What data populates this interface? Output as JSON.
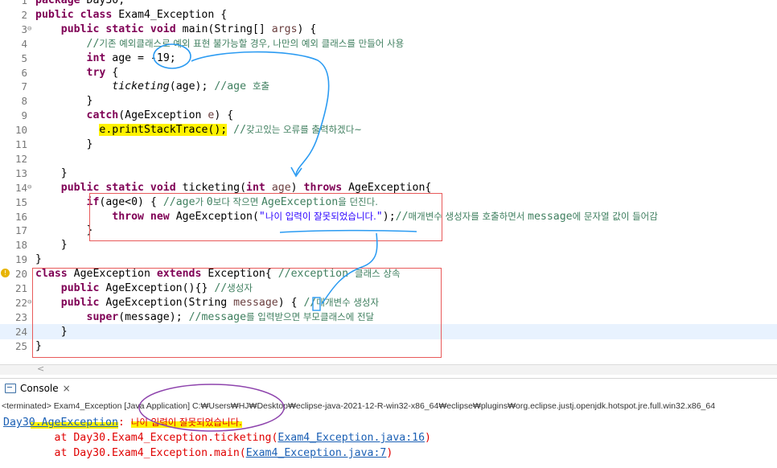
{
  "editor": {
    "lines": [
      {
        "n": "1",
        "parts": [
          {
            "t": "package",
            "c": "kw"
          },
          {
            "t": " Day30;",
            "c": "ident"
          }
        ]
      },
      {
        "n": "2",
        "parts": [
          {
            "t": "public class",
            "c": "kw"
          },
          {
            "t": " Exam4_Exception {",
            "c": "ident"
          }
        ]
      },
      {
        "n": "3",
        "fold": true,
        "parts": [
          {
            "t": "    "
          },
          {
            "t": "public static void",
            "c": "kw"
          },
          {
            "t": " main(String[] ",
            "c": "ident"
          },
          {
            "t": "args",
            "c": "param"
          },
          {
            "t": ") {",
            "c": "ident"
          }
        ]
      },
      {
        "n": "4",
        "parts": [
          {
            "t": "        //",
            "c": "cm"
          },
          {
            "t": "기존 예외클래스로 예외 표현 불가능할 경우, 나만의 예외 클래스를 만들어 사용",
            "c": "cm-ko"
          }
        ]
      },
      {
        "n": "5",
        "parts": [
          {
            "t": "        "
          },
          {
            "t": "int",
            "c": "kw"
          },
          {
            "t": " age = -19;",
            "c": "ident"
          }
        ]
      },
      {
        "n": "6",
        "parts": [
          {
            "t": "        "
          },
          {
            "t": "try",
            "c": "kw"
          },
          {
            "t": " {",
            "c": "ident"
          }
        ]
      },
      {
        "n": "7",
        "parts": [
          {
            "t": "            "
          },
          {
            "t": "ticketing",
            "c": "it"
          },
          {
            "t": "(age); ",
            "c": "ident"
          },
          {
            "t": "//age ",
            "c": "cm"
          },
          {
            "t": "호출",
            "c": "cm-ko"
          }
        ]
      },
      {
        "n": "8",
        "parts": [
          {
            "t": "        }",
            "c": "ident"
          }
        ]
      },
      {
        "n": "9",
        "parts": [
          {
            "t": "        "
          },
          {
            "t": "catch",
            "c": "kw"
          },
          {
            "t": "(AgeException ",
            "c": "ident"
          },
          {
            "t": "e",
            "c": "param"
          },
          {
            "t": ") {",
            "c": "ident"
          }
        ]
      },
      {
        "n": "10",
        "parts": [
          {
            "t": "          "
          },
          {
            "t": "e.printStackTrace();",
            "c": "ident hl-yellow"
          },
          {
            "t": " //",
            "c": "cm"
          },
          {
            "t": "갖고있는 오류를 출력하겠다~",
            "c": "cm-ko"
          }
        ]
      },
      {
        "n": "11",
        "parts": [
          {
            "t": "        }",
            "c": "ident"
          }
        ]
      },
      {
        "n": "12",
        "parts": []
      },
      {
        "n": "13",
        "parts": [
          {
            "t": "    }",
            "c": "ident"
          }
        ]
      },
      {
        "n": "14",
        "fold": true,
        "parts": [
          {
            "t": "    "
          },
          {
            "t": "public static void",
            "c": "kw"
          },
          {
            "t": " ticketing(",
            "c": "ident"
          },
          {
            "t": "int",
            "c": "kw"
          },
          {
            "t": " ",
            "c": "ident"
          },
          {
            "t": "age",
            "c": "param"
          },
          {
            "t": ") ",
            "c": "ident"
          },
          {
            "t": "throws",
            "c": "kw"
          },
          {
            "t": " AgeException{",
            "c": "ident"
          }
        ]
      },
      {
        "n": "15",
        "parts": [
          {
            "t": "        "
          },
          {
            "t": "if",
            "c": "kw"
          },
          {
            "t": "(age<0) { ",
            "c": "ident"
          },
          {
            "t": "//age",
            "c": "cm"
          },
          {
            "t": "가 ",
            "c": "cm-ko"
          },
          {
            "t": "0",
            "c": "cm"
          },
          {
            "t": "보다 작으면 ",
            "c": "cm-ko"
          },
          {
            "t": "AgeException",
            "c": "cm"
          },
          {
            "t": "을 던진다.",
            "c": "cm-ko"
          }
        ]
      },
      {
        "n": "16",
        "parts": [
          {
            "t": "            "
          },
          {
            "t": "throw new",
            "c": "kw"
          },
          {
            "t": " AgeException(",
            "c": "ident"
          },
          {
            "t": "\"",
            "c": "str"
          },
          {
            "t": "나이 입력이 잘못되었습니다.",
            "c": "str-ko"
          },
          {
            "t": "\"",
            "c": "str"
          },
          {
            "t": ");",
            "c": "ident"
          },
          {
            "t": "//",
            "c": "cm"
          },
          {
            "t": "매개변수 생성자를 호출하면서 ",
            "c": "cm-ko"
          },
          {
            "t": "message",
            "c": "cm"
          },
          {
            "t": "에 문자열 값이 들어감",
            "c": "cm-ko"
          }
        ]
      },
      {
        "n": "17",
        "parts": [
          {
            "t": "        }",
            "c": "ident"
          }
        ]
      },
      {
        "n": "18",
        "parts": [
          {
            "t": "    }",
            "c": "ident"
          }
        ]
      },
      {
        "n": "19",
        "parts": [
          {
            "t": "}",
            "c": "ident"
          }
        ]
      },
      {
        "n": "20",
        "warn": true,
        "parts": [
          {
            "t": "class",
            "c": "kw"
          },
          {
            "t": " AgeException ",
            "c": "ident"
          },
          {
            "t": "extends",
            "c": "kw"
          },
          {
            "t": " Exception{ ",
            "c": "ident"
          },
          {
            "t": "//exception ",
            "c": "cm"
          },
          {
            "t": "클래스 상속",
            "c": "cm-ko"
          }
        ]
      },
      {
        "n": "21",
        "parts": [
          {
            "t": "    "
          },
          {
            "t": "public",
            "c": "kw"
          },
          {
            "t": " AgeException(){} ",
            "c": "ident"
          },
          {
            "t": "//",
            "c": "cm"
          },
          {
            "t": "생성자",
            "c": "cm-ko"
          }
        ]
      },
      {
        "n": "22",
        "fold": true,
        "parts": [
          {
            "t": "    "
          },
          {
            "t": "public",
            "c": "kw"
          },
          {
            "t": " AgeException(String ",
            "c": "ident"
          },
          {
            "t": "message",
            "c": "param"
          },
          {
            "t": ") { ",
            "c": "ident"
          },
          {
            "t": "//",
            "c": "cm"
          },
          {
            "t": "매개변수 생성자",
            "c": "cm-ko"
          }
        ]
      },
      {
        "n": "23",
        "parts": [
          {
            "t": "        "
          },
          {
            "t": "super",
            "c": "kw"
          },
          {
            "t": "(message); ",
            "c": "ident"
          },
          {
            "t": "//message",
            "c": "cm"
          },
          {
            "t": "를 입력받으면 부모클래스에 전달",
            "c": "cm-ko"
          }
        ]
      },
      {
        "n": "24",
        "cur": true,
        "parts": [
          {
            "t": "    }",
            "c": "ident"
          }
        ]
      },
      {
        "n": "25",
        "parts": [
          {
            "t": "}",
            "c": "ident"
          }
        ]
      }
    ]
  },
  "console": {
    "tab_label": "Console",
    "terminated": "<terminated> Exam4_Exception [Java Application] C:₩Users₩HJ₩Desktop₩eclipse-java-2021-12-R-win32-x86_64₩eclipse₩plugins₩org.eclipse.justj.openjdk.hotspot.jre.full.win32.x86_64",
    "error_class": "Day30.AgeException",
    "error_sep": ": ",
    "error_message": "나이 입력이 잘못되었습니다.",
    "trace": [
      {
        "prefix": "        at Day30.Exam4_Exception.ticketing(",
        "link": "Exam4_Exception.java:16",
        "suffix": ")"
      },
      {
        "prefix": "        at Day30.Exam4_Exception.main(",
        "link": "Exam4_Exception.java:7",
        "suffix": ")"
      }
    ]
  },
  "colors": {
    "keyword": "#7f0055",
    "comment": "#3f7f5f",
    "string": "#2a00ff",
    "error": "#e00000",
    "link": "#1a5fb4",
    "annotation_box": "#e85a5a",
    "annotation_arrow": "#2b9bf2",
    "annotation_circle": "#8e44ad",
    "highlight": "#fff200"
  }
}
